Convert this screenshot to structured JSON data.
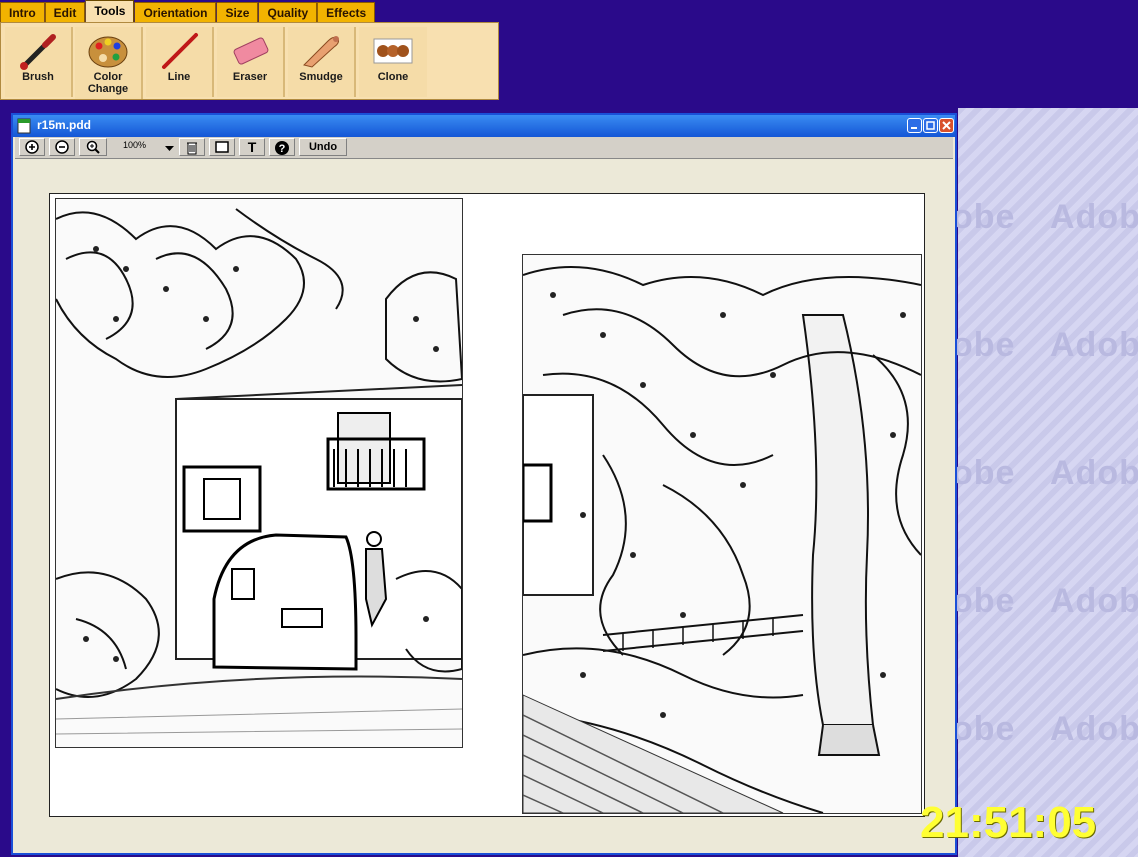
{
  "menu": {
    "tabs": [
      "Intro",
      "Edit",
      "Tools",
      "Orientation",
      "Size",
      "Quality",
      "Effects"
    ],
    "active_tab": "Tools"
  },
  "tools": [
    {
      "label": "Brush",
      "icon": "paintbrush-icon"
    },
    {
      "label": "Color Change",
      "icon": "palette-icon"
    },
    {
      "label": "Line",
      "icon": "line-pen-icon"
    },
    {
      "label": "Eraser",
      "icon": "eraser-icon"
    },
    {
      "label": "Smudge",
      "icon": "smudge-finger-icon"
    },
    {
      "label": "Clone",
      "icon": "clone-dogs-icon"
    }
  ],
  "window": {
    "title": "r15m.pdd",
    "buttons": [
      "minimize",
      "maximize",
      "close"
    ]
  },
  "viewbar": {
    "zoom_in": "zoom-in-icon",
    "zoom_out": "zoom-out-icon",
    "magnify": "magnify-icon",
    "zoom_value": "100%",
    "trash": "trash-icon",
    "frame": "frame-icon",
    "text": "T",
    "help": "?",
    "undo_label": "Undo"
  },
  "clock": "21:51:05",
  "colors": {
    "desktop": "#2a0a8a",
    "window_border": "#1a4fd8",
    "tab": "#f2b300",
    "clock": "#ffff33"
  }
}
